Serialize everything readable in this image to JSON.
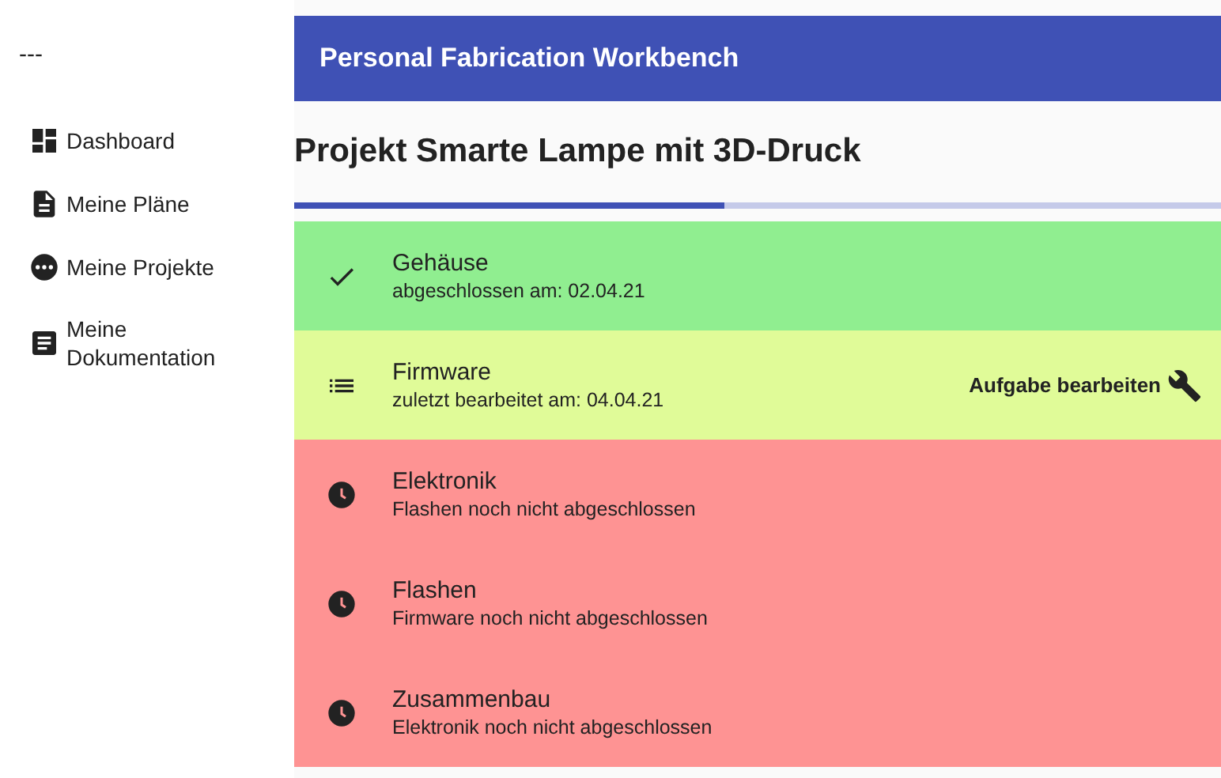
{
  "sidebar": {
    "title": "---",
    "items": [
      {
        "label": "Dashboard"
      },
      {
        "label": "Meine Pläne"
      },
      {
        "label": "Meine Projekte"
      },
      {
        "label": "Meine Dokumentation"
      }
    ]
  },
  "app_bar": {
    "title": "Personal Fabrication Workbench"
  },
  "project": {
    "title": "Projekt Smarte Lampe mit 3D-Druck",
    "progress": {
      "level": 0.464
    }
  },
  "tasks": [
    {
      "kind": "done",
      "title": "Gehäuse",
      "subtitle": "abgeschlossen am: 02.04.21"
    },
    {
      "kind": "active",
      "title": "Firmware",
      "subtitle": "zuletzt bearbeitet am: 04.04.21",
      "action": "Aufgabe bearbeiten"
    },
    {
      "kind": "pending",
      "title": "Elektronik",
      "subtitle": "Flashen noch nicht abgeschlossen"
    },
    {
      "kind": "pending",
      "title": "Flashen",
      "subtitle": "Firmware noch nicht abgeschlossen"
    },
    {
      "kind": "pending",
      "title": "Zusammenbau",
      "subtitle": "Elektronik noch nicht abgeschlossen"
    }
  ]
}
